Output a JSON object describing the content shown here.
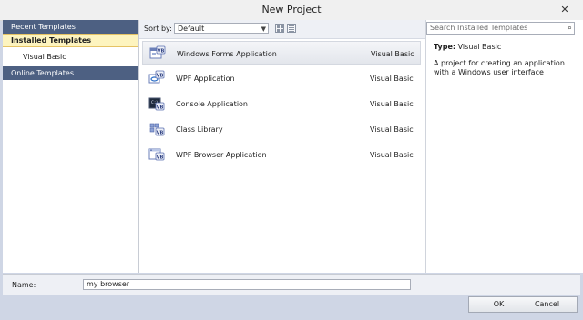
{
  "window": {
    "title": "New Project",
    "close_glyph": "✕"
  },
  "left_nav": {
    "recent": "Recent Templates",
    "installed": "Installed Templates",
    "installed_child": "Visual Basic",
    "online": "Online Templates"
  },
  "toolbar": {
    "sort_label": "Sort by:",
    "sort_value": "Default",
    "view_icons": [
      "medium-icons-view-icon",
      "list-view-icon"
    ]
  },
  "templates": [
    {
      "name": "Windows Forms Application",
      "language": "Visual Basic",
      "icon": "windows-forms-icon",
      "selected": true
    },
    {
      "name": "WPF Application",
      "language": "Visual Basic",
      "icon": "wpf-app-icon",
      "selected": false
    },
    {
      "name": "Console Application",
      "language": "Visual Basic",
      "icon": "console-app-icon",
      "selected": false
    },
    {
      "name": "Class Library",
      "language": "Visual Basic",
      "icon": "class-library-icon",
      "selected": false
    },
    {
      "name": "WPF Browser Application",
      "language": "Visual Basic",
      "icon": "wpf-browser-app-icon",
      "selected": false
    }
  ],
  "details": {
    "search_placeholder": "Search Installed Templates",
    "type_label": "Type:",
    "type_value": "Visual Basic",
    "description": "A project for creating an application with a Windows user interface"
  },
  "footer": {
    "name_label": "Name:",
    "name_value": "my browser",
    "ok_label": "OK",
    "cancel_label": "Cancel"
  },
  "colors": {
    "nav_header": "#4d6082",
    "selection": "#fdf4bf",
    "window_bg": "#cfd6e5",
    "vb_accent": "#5a6fb0"
  }
}
